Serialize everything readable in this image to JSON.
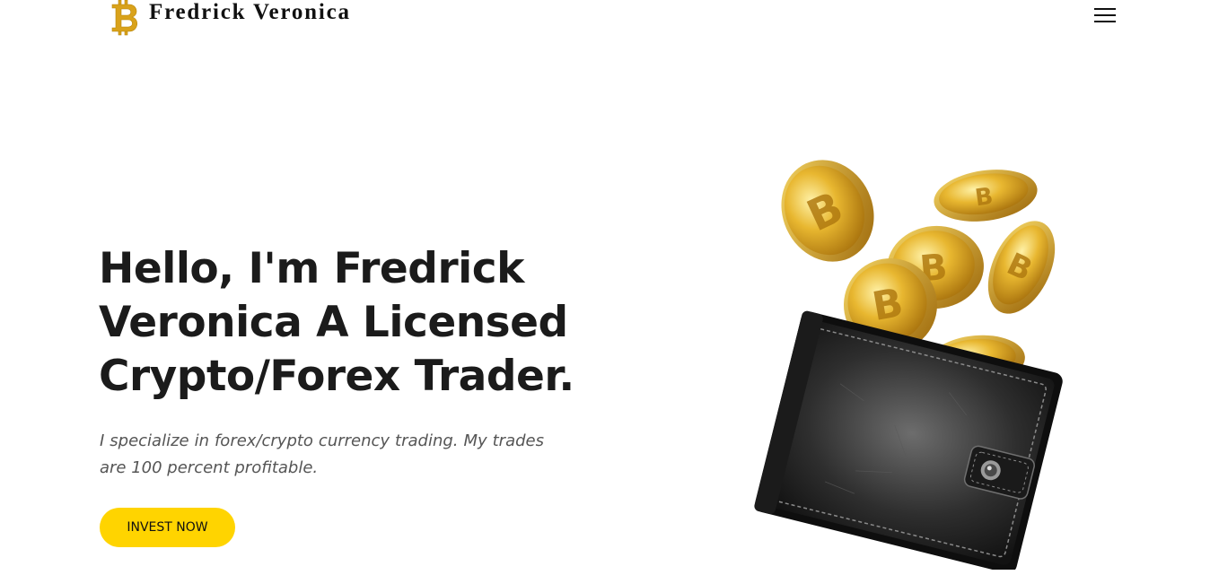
{
  "header": {
    "brand_name": "Fredrick Veronica",
    "logo_icon": "bitcoin-logo-icon",
    "menu_icon": "hamburger-menu-icon"
  },
  "hero": {
    "title_lines": [
      "Hello, I'm Fredrick",
      "Veronica A Licensed",
      "Crypto/Forex Trader."
    ],
    "description": "I specialize in forex/crypto currency trading. My trades are 100 percent profitable.",
    "cta_label": "INVEST NOW",
    "illustration": "wallet-with-bitcoin-coins"
  },
  "colors": {
    "accent": "#ffd400",
    "gold": "#d4a017",
    "heading": "#1b1b1b",
    "body_text": "#555555"
  }
}
